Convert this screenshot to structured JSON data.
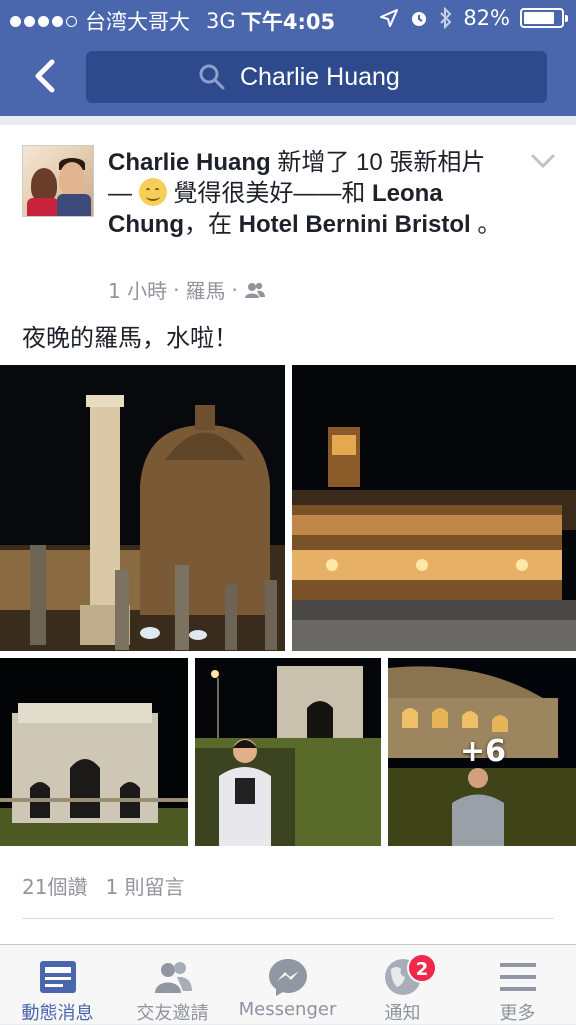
{
  "status_bar": {
    "carrier": "台湾大哥大",
    "network": "3G",
    "time": "下午4:05",
    "battery": "82%",
    "battery_level": 0.82
  },
  "nav": {
    "search_value": "Charlie Huang"
  },
  "post": {
    "author": "Charlie Huang",
    "action_1": " 新增了 10 張新相片 — ",
    "feeling": " 覺得很美好——和 ",
    "tagged": "Leona Chung",
    "at": "，在 ",
    "place": "Hotel Bernini Bristol",
    "end": " 。",
    "time_ago": "1 小時",
    "separator": "·",
    "location": "羅馬",
    "text": "夜晚的羅馬，水啦！",
    "more_photos": "+6",
    "likes": "21個讚",
    "comments": "1 則留言"
  },
  "tabbar": {
    "items": [
      {
        "label": "動態消息",
        "icon": "news-feed-icon",
        "active": true
      },
      {
        "label": "交友邀請",
        "icon": "friends-icon",
        "active": false
      },
      {
        "label": "Messenger",
        "icon": "messenger-icon",
        "active": false
      },
      {
        "label": "通知",
        "icon": "globe-icon",
        "active": false,
        "badge": "2"
      },
      {
        "label": "更多",
        "icon": "menu-icon",
        "active": false
      }
    ]
  },
  "colors": {
    "brand": "#4a67ad",
    "badge": "#f02849"
  }
}
